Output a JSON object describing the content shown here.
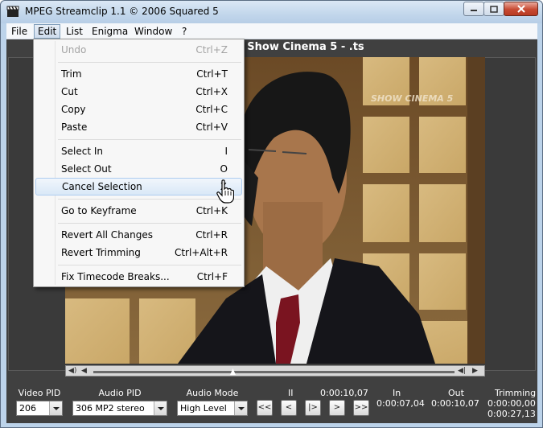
{
  "window": {
    "title": "MPEG Streamclip 1.1 © 2006  Squared 5",
    "file_title": "- Show Cinema 5 - .ts"
  },
  "menubar": {
    "items": [
      {
        "label": "File"
      },
      {
        "label": "Edit"
      },
      {
        "label": "List"
      },
      {
        "label": "Enigma"
      },
      {
        "label": "Window"
      },
      {
        "label": "?"
      }
    ]
  },
  "edit_menu": {
    "items": [
      {
        "label": "Undo",
        "shortcut": "Ctrl+Z",
        "disabled": true
      },
      {
        "label": "Trim",
        "shortcut": "Ctrl+T"
      },
      {
        "label": "Cut",
        "shortcut": "Ctrl+X"
      },
      {
        "label": "Copy",
        "shortcut": "Ctrl+C"
      },
      {
        "label": "Paste",
        "shortcut": "Ctrl+V"
      },
      {
        "label": "Select In",
        "shortcut": "I"
      },
      {
        "label": "Select Out",
        "shortcut": "O"
      },
      {
        "label": "Cancel Selection",
        "shortcut": "X",
        "highlighted": true
      },
      {
        "label": "Go to Keyframe",
        "shortcut": "Ctrl+K"
      },
      {
        "label": "Revert All Changes",
        "shortcut": "Ctrl+R"
      },
      {
        "label": "Revert Trimming",
        "shortcut": "Ctrl+Alt+R"
      },
      {
        "label": "Fix Timecode Breaks...",
        "shortcut": "Ctrl+F"
      }
    ]
  },
  "video": {
    "watermark": "SHOW CINEMA 5"
  },
  "controls": {
    "video_pid": {
      "label": "Video PID",
      "value": "206"
    },
    "audio_pid": {
      "label": "Audio PID",
      "value": "306 MP2 stereo"
    },
    "audio_mode": {
      "label": "Audio Mode",
      "value": "High Level"
    },
    "transport": {
      "rewind_label": "<<",
      "prev_label": "<",
      "play_label": "|>",
      "next_label": ">",
      "forward_label": ">>"
    },
    "pause_indicator": "II",
    "current_time": "0:00:10,07",
    "in": {
      "label": "In",
      "value": "0:00:07,04"
    },
    "out": {
      "label": "Out",
      "value": "0:00:10,07"
    },
    "trimming": {
      "label": "Trimming",
      "value": "0:00:00,00",
      "total": "0:00:27,13"
    }
  },
  "colors": {
    "client_bg": "#404040",
    "menu_hover": "#d9e8f7",
    "titlebar": "#c4d8ec",
    "close_button": "#c74a32"
  }
}
